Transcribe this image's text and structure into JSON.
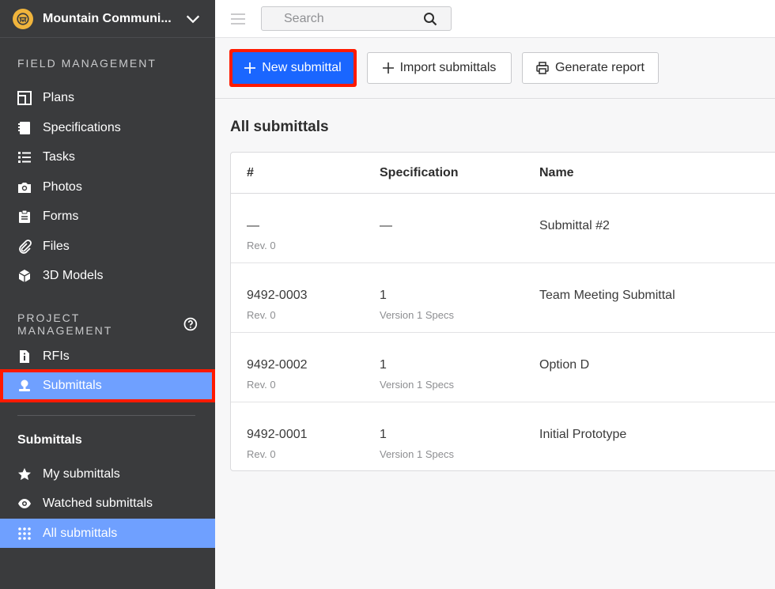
{
  "project": {
    "name": "Mountain Communi..."
  },
  "sidebar": {
    "field_label": "FIELD MANAGEMENT",
    "field_items": [
      {
        "label": "Plans",
        "icon": "plans-icon"
      },
      {
        "label": "Specifications",
        "icon": "specifications-icon"
      },
      {
        "label": "Tasks",
        "icon": "tasks-icon"
      },
      {
        "label": "Photos",
        "icon": "camera-icon"
      },
      {
        "label": "Forms",
        "icon": "forms-icon"
      },
      {
        "label": "Files",
        "icon": "paperclip-icon"
      },
      {
        "label": "3D Models",
        "icon": "cube-icon"
      }
    ],
    "project_label": "PROJECT MANAGEMENT",
    "project_items": [
      {
        "label": "RFIs",
        "icon": "rfi-icon"
      },
      {
        "label": "Submittals",
        "icon": "submittals-icon"
      }
    ],
    "submittals_title": "Submittals",
    "submittal_items": [
      {
        "label": "My submittals",
        "icon": "star-icon"
      },
      {
        "label": "Watched submittals",
        "icon": "eye-icon"
      },
      {
        "label": "All submittals",
        "icon": "grid-icon"
      }
    ]
  },
  "search": {
    "placeholder": "Search"
  },
  "toolbar": {
    "new_label": "New submittal",
    "import_label": "Import submittals",
    "report_label": "Generate report"
  },
  "main": {
    "title": "All submittals",
    "columns": [
      "#",
      "Specification",
      "Name"
    ],
    "rows": [
      {
        "number": "—",
        "rev": "Rev. 0",
        "spec": "—",
        "spec_version": "",
        "name": "Submittal #2"
      },
      {
        "number": "9492-0003",
        "rev": "Rev. 0",
        "spec": "1",
        "spec_version": "Version 1 Specs",
        "name": "Team Meeting Submittal"
      },
      {
        "number": "9492-0002",
        "rev": "Rev. 0",
        "spec": "1",
        "spec_version": "Version 1 Specs",
        "name": "Option D"
      },
      {
        "number": "9492-0001",
        "rev": "Rev. 0",
        "spec": "1",
        "spec_version": "Version 1 Specs",
        "name": "Initial Prototype"
      }
    ]
  },
  "colors": {
    "sidebar_bg": "#3a3b3d",
    "active_bg": "#6fa0ff",
    "primary": "#1a66ff",
    "highlight": "#ff1a00"
  }
}
